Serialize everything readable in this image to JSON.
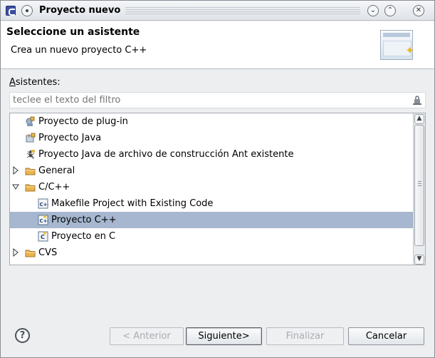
{
  "window": {
    "title": "Proyecto nuevo"
  },
  "header": {
    "title": "Seleccione un asistente",
    "description": "Crea un nuevo proyecto C++"
  },
  "wizards": {
    "label_first": "A",
    "label_rest": "sistentes:",
    "filter_placeholder": "teclee el texto del filtro",
    "tree": [
      {
        "label": "Proyecto de plug-in",
        "level": 1,
        "icon": "plugin-project-icon",
        "expanded": null,
        "selected": false
      },
      {
        "label": "Proyecto Java",
        "level": 1,
        "icon": "java-project-icon",
        "expanded": null,
        "selected": false
      },
      {
        "label": "Proyecto Java de archivo de construcción Ant existente",
        "level": 1,
        "icon": "ant-project-icon",
        "expanded": null,
        "selected": false
      },
      {
        "label": "General",
        "level": 0,
        "icon": "folder-icon",
        "expanded": false,
        "selected": false
      },
      {
        "label": "C/C++",
        "level": 0,
        "icon": "folder-icon",
        "expanded": true,
        "selected": false
      },
      {
        "label": "Makefile Project with Existing Code",
        "level": 2,
        "icon": "cpp-file-icon",
        "expanded": null,
        "selected": false
      },
      {
        "label": "Proyecto C++",
        "level": 2,
        "icon": "cpp-project-icon",
        "expanded": null,
        "selected": true
      },
      {
        "label": "Proyecto en C",
        "level": 2,
        "icon": "c-project-icon",
        "expanded": null,
        "selected": false
      },
      {
        "label": "CVS",
        "level": 0,
        "icon": "folder-icon",
        "expanded": false,
        "selected": false
      }
    ]
  },
  "buttons": {
    "help_label": "?",
    "back_label": "< Anterior",
    "back_mnemonic": "A",
    "next_label": "Siguiente>",
    "finish_label": "Finalizar",
    "cancel_label": "Cancelar"
  },
  "colors": {
    "selection": "#a6b7cf",
    "folder": "#e9b44c",
    "window_bg": "#eceef0"
  }
}
